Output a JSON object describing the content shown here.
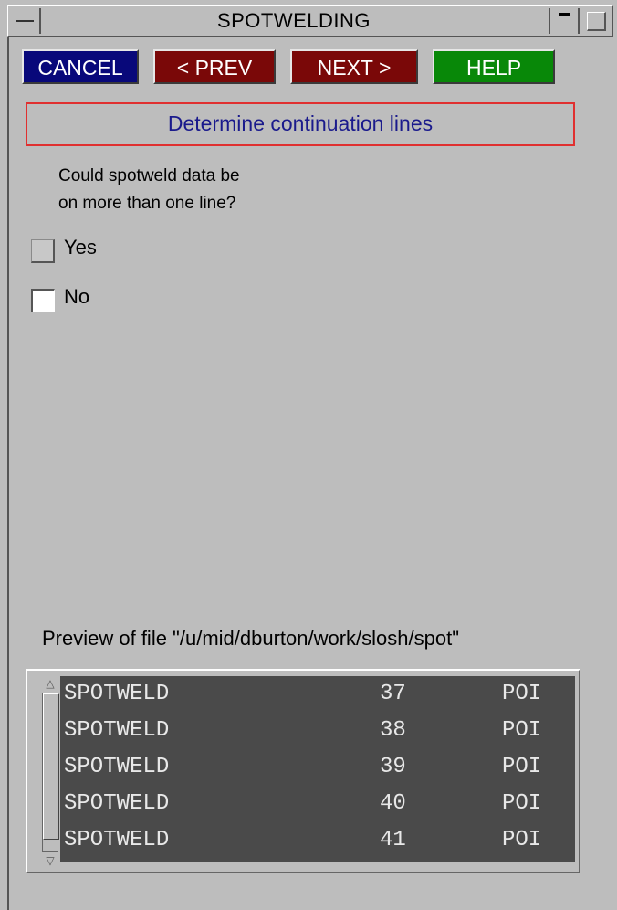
{
  "window": {
    "title": "SPOTWELDING"
  },
  "toolbar": {
    "cancel_label": "CANCEL",
    "prev_label": "< PREV",
    "next_label": "NEXT >",
    "help_label": "HELP"
  },
  "step": {
    "heading": "Determine continuation lines",
    "question_line1": "Could spotweld data be",
    "question_line2": "on more than one line?",
    "options": [
      {
        "label": "Yes",
        "checked": false
      },
      {
        "label": "No",
        "checked": true
      }
    ]
  },
  "preview": {
    "label": "Preview of file \"/u/mid/dburton/work/slosh/spot\"",
    "rows": [
      {
        "col1": "SPOTWELD",
        "col2": "37",
        "col3": "POI"
      },
      {
        "col1": "SPOTWELD",
        "col2": "38",
        "col3": "POI"
      },
      {
        "col1": "SPOTWELD",
        "col2": "39",
        "col3": "POI"
      },
      {
        "col1": "SPOTWELD",
        "col2": "40",
        "col3": "POI"
      },
      {
        "col1": "SPOTWELD",
        "col2": "41",
        "col3": "POI"
      }
    ]
  },
  "icons": {
    "window_menu": "window-menu-icon",
    "minimize": "minimize-icon",
    "maximize": "maximize-icon",
    "scroll_up": "scroll-up-arrow-icon",
    "scroll_down": "scroll-down-arrow-icon"
  },
  "colors": {
    "cancel_bg": "#08087a",
    "prev_bg": "#7a0808",
    "next_bg": "#7a0808",
    "help_bg": "#088808",
    "heading_border": "#e03030",
    "heading_text": "#1a1a8c",
    "preview_bg": "#4a4a4a"
  }
}
